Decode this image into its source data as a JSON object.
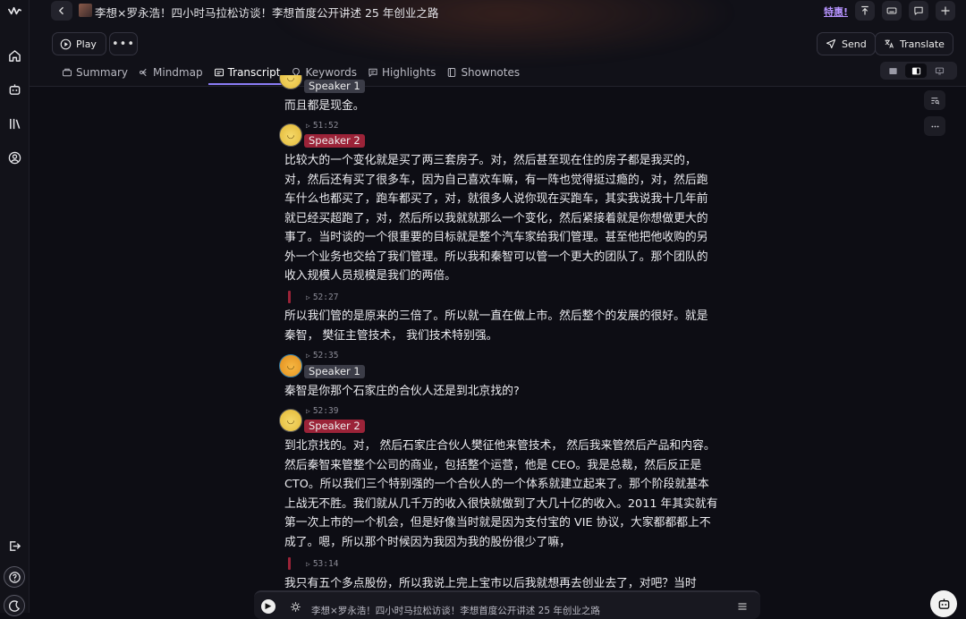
{
  "header": {
    "title": "李想×罗永浩！四小时马拉松访谈！李想首度公开讲述 25 年创业之路",
    "promo": "特惠!",
    "play_label": "Play",
    "more_label": "•••",
    "send_label": "Send",
    "translate_label": "Translate"
  },
  "tabs": [
    {
      "label": "Summary",
      "icon": "summary-icon"
    },
    {
      "label": "Mindmap",
      "icon": "mindmap-icon"
    },
    {
      "label": "Transcript",
      "icon": "transcript-icon",
      "active": true
    },
    {
      "label": "Keywords",
      "icon": "keywords-icon"
    },
    {
      "label": "Highlights",
      "icon": "highlights-icon"
    },
    {
      "label": "Shownotes",
      "icon": "shownotes-icon"
    }
  ],
  "transcript": [
    {
      "speaker": "Speaker 1",
      "time": "",
      "text": "而且都是现金。"
    },
    {
      "speaker": "Speaker 2",
      "time": "51:52",
      "text": "比较大的一个变化就是买了两三套房子。对，然后甚至现在住的房子都是我买的，对，然后还有买了很多车，因为自己喜欢车嘛，有一阵也觉得挺过瘾的，对，然后跑车什么也都买了，跑车都买了，对，就很多人说你现在买跑车，其实我说我十几年前就已经买超跑了，对，然后所以我就就那么一个变化，然后紧接着就是你想做更大的事了。当时谈的一个很重要的目标就是整个汽车家给我们管理。甚至他把他收购的另外一个业务也交给了我们管理。所以我和秦智可以管一个更大的团队了。那个团队的收入规模人员规模是我们的两倍。"
    },
    {
      "speaker": "",
      "time": "52:27",
      "text": "所以我们管的是原来的三倍了。所以就一直在做上市。然后整个的发展的很好。就是秦智， 樊征主管技术， 我们技术特别强。"
    },
    {
      "speaker": "Speaker 1",
      "time": "52:35",
      "text": "秦智是你那个石家庄的合伙人还是到北京找的?"
    },
    {
      "speaker": "Speaker 2",
      "time": "52:39",
      "text": "到北京找的。对， 然后石家庄合伙人樊征他来管技术， 然后我来管然后产品和内容。然后秦智来管整个公司的商业，包括整个运营，他是 CEO。我是总裁，然后反正是 CTO。所以我们三个特别强的一个合伙人的一个体系就建立起来了。那个阶段就基本上战无不胜。我们就从几千万的收入很快就做到了大几十亿的收入。2011 年其实就有第一次上市的一个机会，但是好像当时就是因为支付宝的 VIE 协议，大家都都都上不成了。嗯，所以那个时候因为我因为我的股份很少了嘛，"
    },
    {
      "speaker": "",
      "time": "53:14",
      "text": "我只有五个多点股份，所以我说上完上宝市以后我就想再去创业去了，对吧？当时"
    }
  ],
  "player": {
    "title": "李想×罗永浩！四小时马拉松访谈！李想首度公开讲述 25 年创业之路"
  }
}
